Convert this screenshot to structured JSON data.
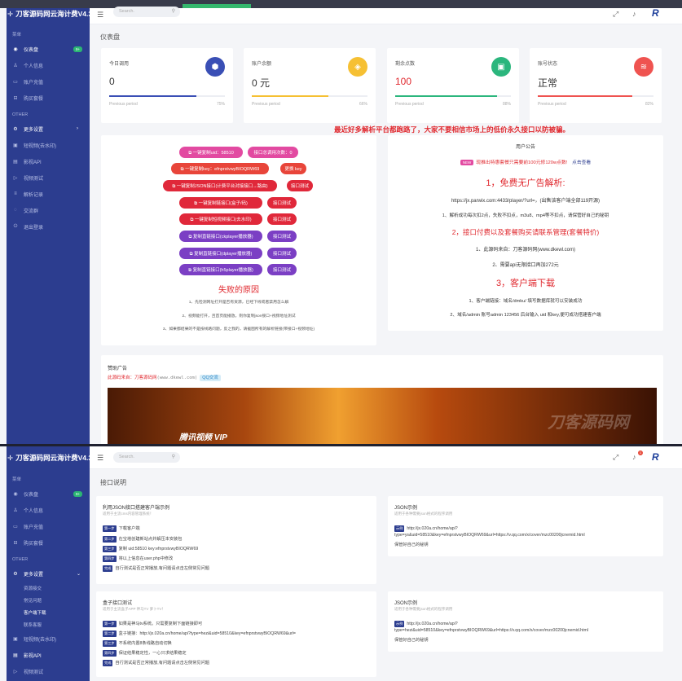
{
  "app": {
    "title": "刀客源码网云海计费V4.3",
    "search_placeholder": "Search."
  },
  "sidebar1": {
    "section_main": "菜单",
    "items": [
      {
        "label": "仪表盘",
        "badge": "9+"
      },
      {
        "label": "个人信息"
      },
      {
        "label": "账户充值"
      },
      {
        "label": "购买套餐"
      }
    ],
    "section_other": "OTHER",
    "more": "更多设置",
    "others": [
      {
        "label": "短视频(去水印)"
      },
      {
        "label": "影视API"
      },
      {
        "label": "视频测试"
      },
      {
        "label": "解析记录"
      },
      {
        "label": "交流群"
      },
      {
        "label": "退出登录"
      }
    ]
  },
  "sidebar2": {
    "section_main": "菜单",
    "items": [
      {
        "label": "仪表盘",
        "badge": "9+"
      },
      {
        "label": "个人信息"
      },
      {
        "label": "账户充值"
      },
      {
        "label": "购买套餐"
      }
    ],
    "section_other": "OTHER",
    "more": "更多设置",
    "subs": [
      "资源接交",
      "常见问题",
      "客户端下载",
      "联系客服"
    ],
    "others": [
      {
        "label": "短视频(去水印)"
      },
      {
        "label": "影视API"
      },
      {
        "label": "视频测试"
      }
    ]
  },
  "notif_count": "1",
  "dashboard": {
    "title": "仪表盘",
    "period_label": "Previous period",
    "stats": [
      {
        "label": "今日调用",
        "value": "0",
        "icon": "cube-icon",
        "color": "#3a4fb5",
        "percent": "75%",
        "fill": 0.75
      },
      {
        "label": "账户余额",
        "value": "0 元",
        "icon": "tag-icon",
        "color": "#f6c033",
        "percent": "66%",
        "fill": 0.66
      },
      {
        "label": "剩余点数",
        "value": "100",
        "icon": "bag-icon",
        "color": "#2bb67d",
        "percent": "88%",
        "fill": 0.88
      },
      {
        "label": "账号状态",
        "value": "正常",
        "icon": "layers-icon",
        "color": "#ef5350",
        "percent": "82%",
        "fill": 0.82
      }
    ]
  },
  "warning": "最近好多解析平台都跑路了，大家不要相信市场上的低价永久接口以防被骗。",
  "actions": [
    {
      "btn": "一键复制uid：58510",
      "btn_color": "#e24aa1",
      "sub": "接口总调用次数：0",
      "sub_color": "#e24aa1"
    },
    {
      "btn": "一键复制key：efnprstvwyBIOQRW69",
      "btn_color": "#e8453a",
      "sub": "更换 key",
      "sub_color": "#e8453a"
    },
    {
      "btn": "一键复制JSON接口(计费平台对接接口→路由)",
      "btn_color": "#e0283a",
      "sub": "接口测试",
      "sub_color": "#e0283a"
    },
    {
      "btn": "一键复制链接口(盒子/码)",
      "btn_color": "#e0283a",
      "sub": "接口测试",
      "sub_color": "#e0283a"
    },
    {
      "btn": "一键复制短视频接口(去水印)",
      "btn_color": "#e0283a",
      "sub": "接口测试",
      "sub_color": "#e0283a"
    },
    {
      "btn": "复制直链接口(ckplayer播放器)",
      "btn_color": "#7b3fc4",
      "sub": "接口测试",
      "sub_color": "#7b3fc4"
    },
    {
      "btn": "复制直链接口(dplayer播放器)",
      "btn_color": "#7b3fc4",
      "sub": "接口测试",
      "sub_color": "#7b3fc4"
    },
    {
      "btn": "复制直链接口(h5player播放器)",
      "btn_color": "#7b3fc4",
      "sub": "接口测试",
      "sub_color": "#7b3fc4"
    }
  ],
  "failure": {
    "title": "失败的原因",
    "notes": [
      "1、先检测网址打开是否有资源，已经下线或者禁用怎么解",
      "2、视频能打开，且首页能播放，则你复制json接口+视频地址测试",
      "3、如果都结果的不是按线路问题，反之我的，请截图所有的解析链接(带接口+视频地址)"
    ]
  },
  "announce": {
    "title": "用户公告",
    "new": "NEW",
    "promo": "现推出特惠套餐只需要前100元修120w点数!",
    "promo_link": "点击查看",
    "h1": "1，免费无广告解析:",
    "url": "https://jx.parwix.com:4433/player/?url=，(出售该客户端全部119开源)",
    "d1": "1、解析成功每次扣2点，失败不扣点，m3u8、mp4等不扣点，请保管好自己的秘钥",
    "h2": "2，接口付费以及套餐购买请联系管理(套餐特价)",
    "d2a": "1、此源码来自：刀客源码网(www.dkewl.com)",
    "d2b": "2、需要api无限接口再加272元",
    "h3": "3，客户端下载",
    "d3a": "1、客户端链接：域名/dmku/ 填写数据库就可以安装成功",
    "d3b": "2、域名/admin 账号admin 123456 后台输入 uid 和key,便可成功搭建客户端"
  },
  "ad": {
    "title": "赞助广告",
    "line": "此源码来自：刀客源码网",
    "site": "(www.dkewl.com)",
    "qq": "QQ交流",
    "vip": "腾讯视频 VIP",
    "watermark": "刀客源码网"
  },
  "docs": {
    "title": "接口说明",
    "c1": {
      "title": "利用JSON接口搭建客户端示例",
      "sub": "适用于主流cms内容管理系统！",
      "steps": [
        [
          "第一步",
          "下载客户端"
        ],
        [
          "第二步",
          "在宝塔创建新站点并解压本安装包"
        ],
        [
          "第三步",
          "复制 uid:58510 key:efnprstvwyBIOQRW69"
        ],
        [
          "第四步",
          "将以上信息在user.php中修改"
        ],
        [
          "完成",
          "自行测试是否正常播放,有问题请点击左侧常见问题"
        ]
      ]
    },
    "c2": {
      "title": "JSON示例",
      "sub": "适用于各种需要json格式的程序调用",
      "tag": "示例",
      "url1": "http://jx.020a.cn/home/api?",
      "url2": "type=ys&uid=58510&key=efnprstvwyBIOQRW69&url=https://v.qq.com/x/cover/mzc00200jcnemid.html",
      "note": "保管好自己的秘钥"
    },
    "c3": {
      "title": "盒子接口测试",
      "sub": "适用于主流盒子APP 神马TV 萝卜TV！",
      "steps": [
        [
          "第一步",
          "如果是神马tv系统。只需要复制下面链接即可"
        ],
        [
          "第二步",
          "盒子链接：http://jx.020a.cn/home/api?type=hezi&uid=58510&key=efnprstvwyBIOQRW69&url="
        ],
        [
          "第三步",
          "不系统内置8条线路自动切换"
        ],
        [
          "第四步",
          "保证结果稳定性，一心只求结果稳定"
        ],
        [
          "完成",
          "自行测试是否正常播放,有问题请点击左侧常见问题"
        ]
      ]
    },
    "c4": {
      "title": "JSON示例",
      "sub": "适用于各种需要json格式的程序调用",
      "tag": "示例",
      "url1": "http://jx.020a.cn/home/api?",
      "url2": "type=hezi&uid=58510&key=efnprstvwyBIOQRW69&url=https://v.qq.com/x/cover/mzc00200jcnemid.html",
      "note": "保管好自己的秘钥"
    }
  }
}
